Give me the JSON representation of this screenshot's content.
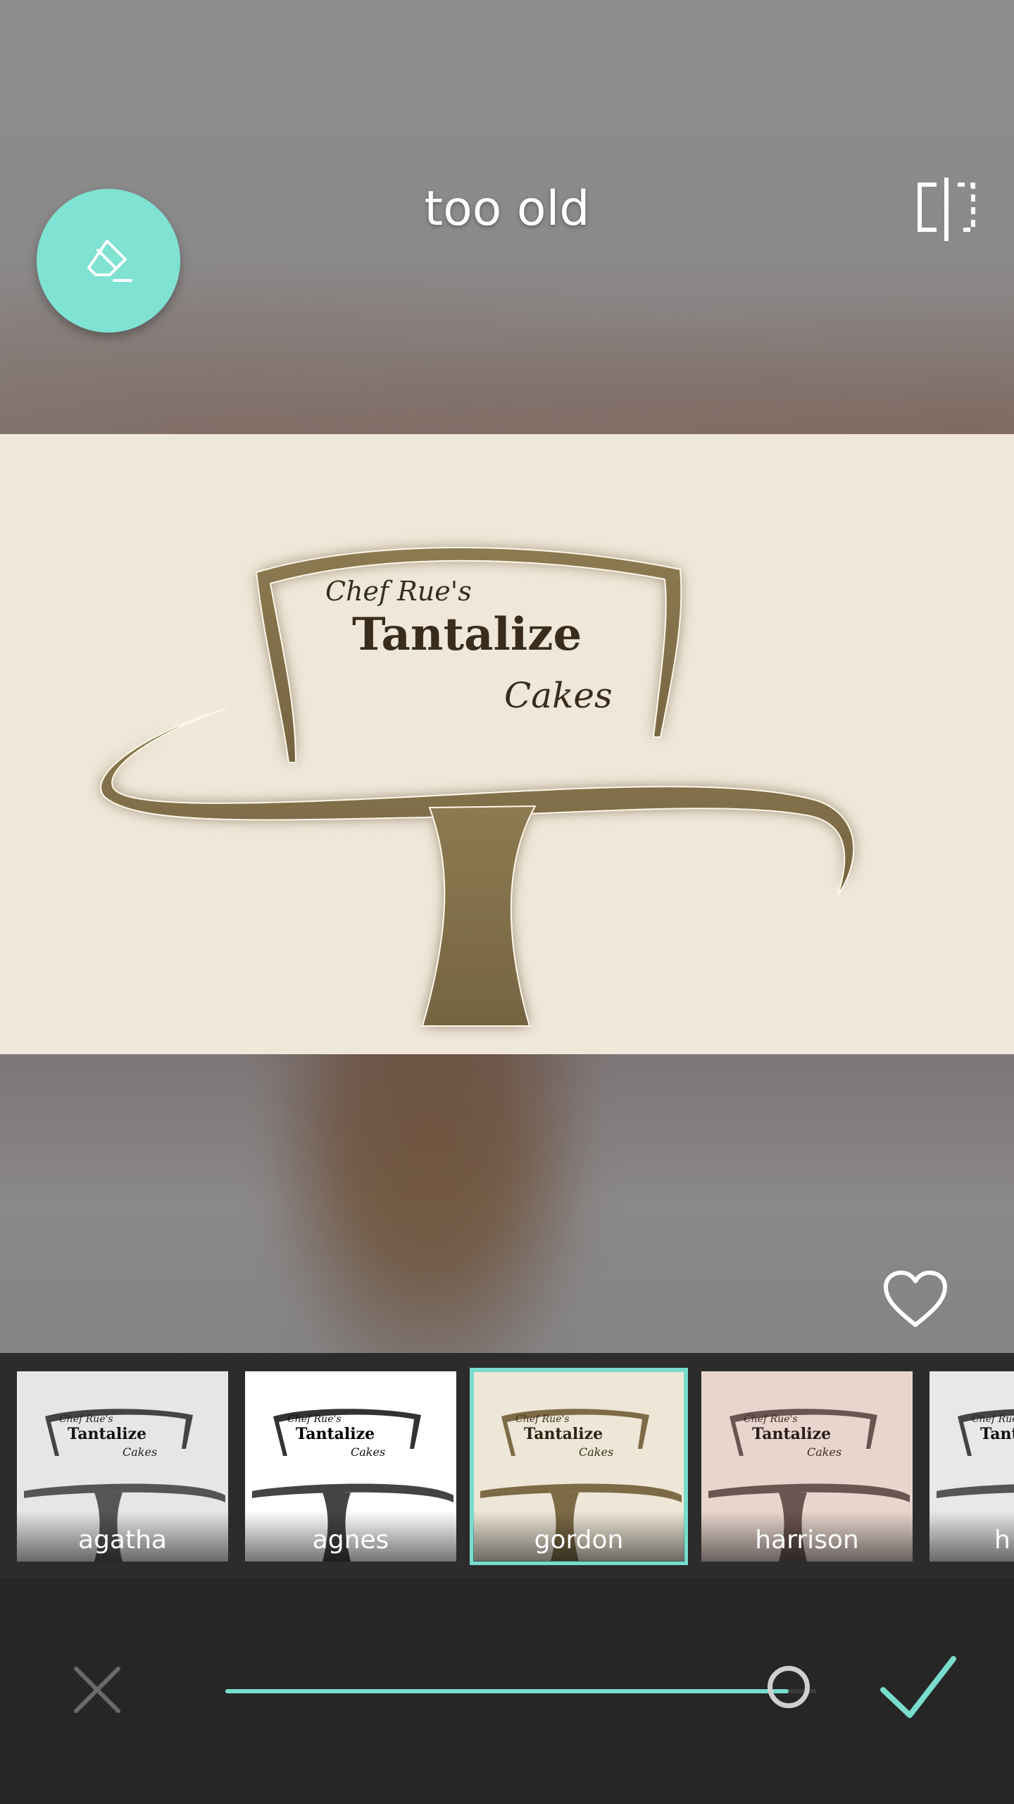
{
  "header": {
    "title": "too old"
  },
  "logo": {
    "line1": "Chef Rue's",
    "line2": "Tantalize",
    "line3": "Cakes"
  },
  "filters": [
    {
      "label": "agatha",
      "tone": "#e6e6e6",
      "selected": false
    },
    {
      "label": "agnes",
      "tone": "#ffffff",
      "selected": false
    },
    {
      "label": "gordon",
      "tone": "#eee6d6",
      "selected": true
    },
    {
      "label": "harrison",
      "tone": "#e8d6ce",
      "selected": false
    },
    {
      "label": "h",
      "tone": "#e8e8e8",
      "selected": false
    }
  ],
  "strength": {
    "value": 1.0
  },
  "colors": {
    "accent": "#79dccc",
    "eraser_bg": "#7fe2d3"
  }
}
